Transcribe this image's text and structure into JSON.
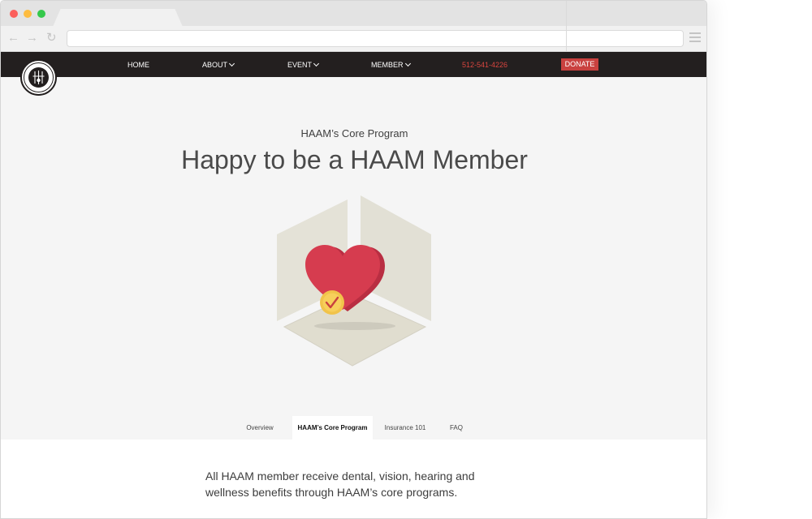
{
  "browser": {
    "url": "",
    "traffic_lights": [
      "close",
      "minimize",
      "zoom"
    ]
  },
  "nav": {
    "logo_icon": "haam-seal-logo",
    "home": "HOME",
    "about": "ABOUT",
    "event": "EVENT",
    "member": "MEMBER",
    "phone": "512-541-4226",
    "donate": "DONATE",
    "colors": {
      "bar": "#231f1f",
      "phone": "#d9453f",
      "donate_bg": "#c9413f"
    }
  },
  "hero": {
    "eyebrow": "HAAM’s Core Program",
    "headline": "Happy to be a HAAM Member",
    "illustration_icon": "heart-check-icon",
    "colors": {
      "heart": "#d63c4f",
      "check_badge": "#f7cf5b",
      "panel": "#e4e2d7"
    }
  },
  "tabs": [
    {
      "label": "Overview",
      "active": false
    },
    {
      "label": "HAAM’s Core Program",
      "active": true
    },
    {
      "label": "Insurance 101",
      "active": false
    },
    {
      "label": "FAQ",
      "active": false
    }
  ],
  "content": {
    "paragraph": "All HAAM member receive dental, vision, hearing and wellness benefits through HAAM’s core programs."
  }
}
